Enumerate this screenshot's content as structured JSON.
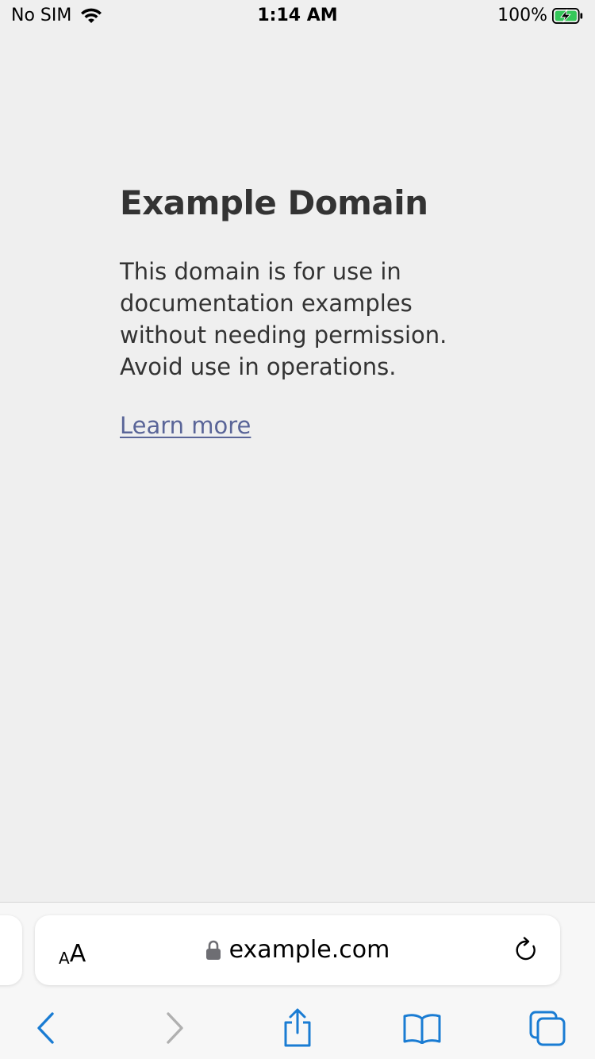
{
  "status_bar": {
    "carrier": "No SIM",
    "time": "1:14 AM",
    "battery_percent": "100%",
    "battery_level": 1.0,
    "battery_color": "#34c759",
    "wifi_icon": "wifi-icon"
  },
  "page": {
    "title": "Example Domain",
    "body": "This domain is for use in documentation examples without needing permission. Avoid use in operations.",
    "link_text": "Learn more"
  },
  "address_bar": {
    "reader_small": "A",
    "reader_large": "A",
    "url": "example.com",
    "lock_icon": "lock-icon",
    "reload_icon": "reload-icon"
  },
  "toolbar": {
    "icons": [
      "back-icon",
      "forward-icon",
      "share-icon",
      "bookmarks-icon",
      "tabs-icon"
    ],
    "accent_color": "#1a7cd3",
    "disabled_color": "#b0b0b0"
  }
}
